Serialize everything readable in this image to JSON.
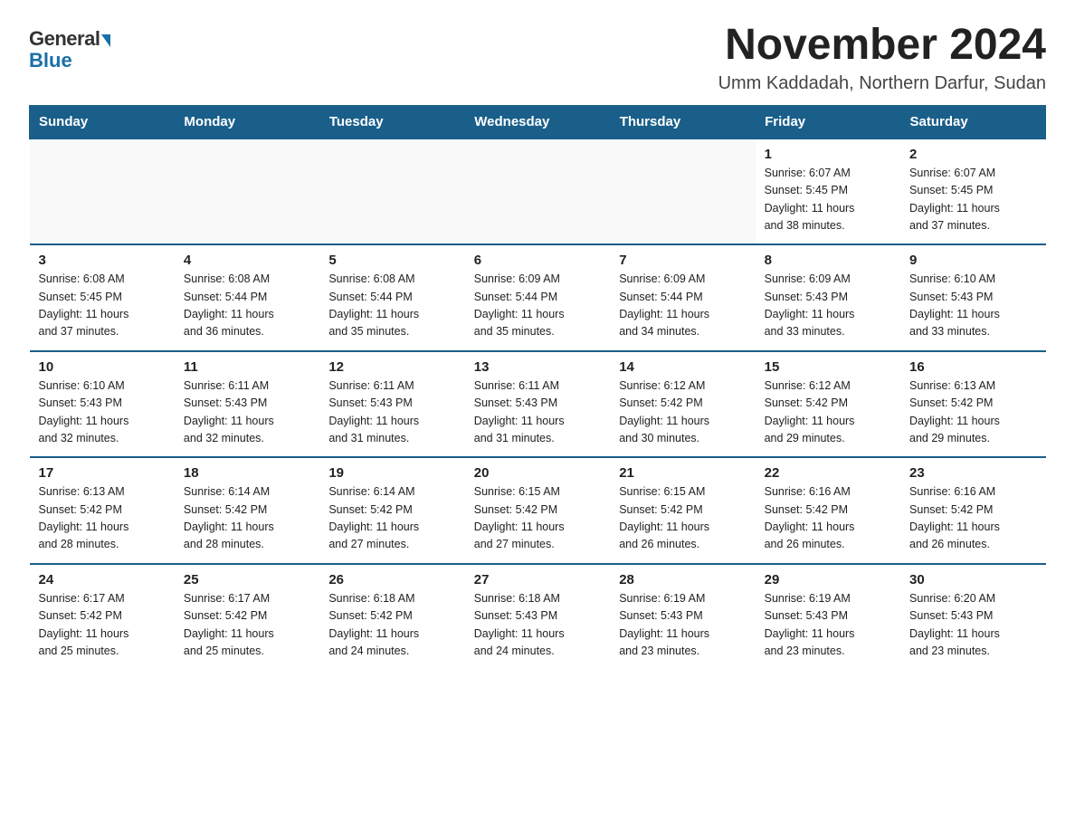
{
  "logo": {
    "general": "General",
    "blue": "Blue"
  },
  "title": "November 2024",
  "subtitle": "Umm Kaddadah, Northern Darfur, Sudan",
  "days_of_week": [
    "Sunday",
    "Monday",
    "Tuesday",
    "Wednesday",
    "Thursday",
    "Friday",
    "Saturday"
  ],
  "weeks": [
    [
      {
        "day": "",
        "detail": ""
      },
      {
        "day": "",
        "detail": ""
      },
      {
        "day": "",
        "detail": ""
      },
      {
        "day": "",
        "detail": ""
      },
      {
        "day": "",
        "detail": ""
      },
      {
        "day": "1",
        "detail": "Sunrise: 6:07 AM\nSunset: 5:45 PM\nDaylight: 11 hours\nand 38 minutes."
      },
      {
        "day": "2",
        "detail": "Sunrise: 6:07 AM\nSunset: 5:45 PM\nDaylight: 11 hours\nand 37 minutes."
      }
    ],
    [
      {
        "day": "3",
        "detail": "Sunrise: 6:08 AM\nSunset: 5:45 PM\nDaylight: 11 hours\nand 37 minutes."
      },
      {
        "day": "4",
        "detail": "Sunrise: 6:08 AM\nSunset: 5:44 PM\nDaylight: 11 hours\nand 36 minutes."
      },
      {
        "day": "5",
        "detail": "Sunrise: 6:08 AM\nSunset: 5:44 PM\nDaylight: 11 hours\nand 35 minutes."
      },
      {
        "day": "6",
        "detail": "Sunrise: 6:09 AM\nSunset: 5:44 PM\nDaylight: 11 hours\nand 35 minutes."
      },
      {
        "day": "7",
        "detail": "Sunrise: 6:09 AM\nSunset: 5:44 PM\nDaylight: 11 hours\nand 34 minutes."
      },
      {
        "day": "8",
        "detail": "Sunrise: 6:09 AM\nSunset: 5:43 PM\nDaylight: 11 hours\nand 33 minutes."
      },
      {
        "day": "9",
        "detail": "Sunrise: 6:10 AM\nSunset: 5:43 PM\nDaylight: 11 hours\nand 33 minutes."
      }
    ],
    [
      {
        "day": "10",
        "detail": "Sunrise: 6:10 AM\nSunset: 5:43 PM\nDaylight: 11 hours\nand 32 minutes."
      },
      {
        "day": "11",
        "detail": "Sunrise: 6:11 AM\nSunset: 5:43 PM\nDaylight: 11 hours\nand 32 minutes."
      },
      {
        "day": "12",
        "detail": "Sunrise: 6:11 AM\nSunset: 5:43 PM\nDaylight: 11 hours\nand 31 minutes."
      },
      {
        "day": "13",
        "detail": "Sunrise: 6:11 AM\nSunset: 5:43 PM\nDaylight: 11 hours\nand 31 minutes."
      },
      {
        "day": "14",
        "detail": "Sunrise: 6:12 AM\nSunset: 5:42 PM\nDaylight: 11 hours\nand 30 minutes."
      },
      {
        "day": "15",
        "detail": "Sunrise: 6:12 AM\nSunset: 5:42 PM\nDaylight: 11 hours\nand 29 minutes."
      },
      {
        "day": "16",
        "detail": "Sunrise: 6:13 AM\nSunset: 5:42 PM\nDaylight: 11 hours\nand 29 minutes."
      }
    ],
    [
      {
        "day": "17",
        "detail": "Sunrise: 6:13 AM\nSunset: 5:42 PM\nDaylight: 11 hours\nand 28 minutes."
      },
      {
        "day": "18",
        "detail": "Sunrise: 6:14 AM\nSunset: 5:42 PM\nDaylight: 11 hours\nand 28 minutes."
      },
      {
        "day": "19",
        "detail": "Sunrise: 6:14 AM\nSunset: 5:42 PM\nDaylight: 11 hours\nand 27 minutes."
      },
      {
        "day": "20",
        "detail": "Sunrise: 6:15 AM\nSunset: 5:42 PM\nDaylight: 11 hours\nand 27 minutes."
      },
      {
        "day": "21",
        "detail": "Sunrise: 6:15 AM\nSunset: 5:42 PM\nDaylight: 11 hours\nand 26 minutes."
      },
      {
        "day": "22",
        "detail": "Sunrise: 6:16 AM\nSunset: 5:42 PM\nDaylight: 11 hours\nand 26 minutes."
      },
      {
        "day": "23",
        "detail": "Sunrise: 6:16 AM\nSunset: 5:42 PM\nDaylight: 11 hours\nand 26 minutes."
      }
    ],
    [
      {
        "day": "24",
        "detail": "Sunrise: 6:17 AM\nSunset: 5:42 PM\nDaylight: 11 hours\nand 25 minutes."
      },
      {
        "day": "25",
        "detail": "Sunrise: 6:17 AM\nSunset: 5:42 PM\nDaylight: 11 hours\nand 25 minutes."
      },
      {
        "day": "26",
        "detail": "Sunrise: 6:18 AM\nSunset: 5:42 PM\nDaylight: 11 hours\nand 24 minutes."
      },
      {
        "day": "27",
        "detail": "Sunrise: 6:18 AM\nSunset: 5:43 PM\nDaylight: 11 hours\nand 24 minutes."
      },
      {
        "day": "28",
        "detail": "Sunrise: 6:19 AM\nSunset: 5:43 PM\nDaylight: 11 hours\nand 23 minutes."
      },
      {
        "day": "29",
        "detail": "Sunrise: 6:19 AM\nSunset: 5:43 PM\nDaylight: 11 hours\nand 23 minutes."
      },
      {
        "day": "30",
        "detail": "Sunrise: 6:20 AM\nSunset: 5:43 PM\nDaylight: 11 hours\nand 23 minutes."
      }
    ]
  ]
}
